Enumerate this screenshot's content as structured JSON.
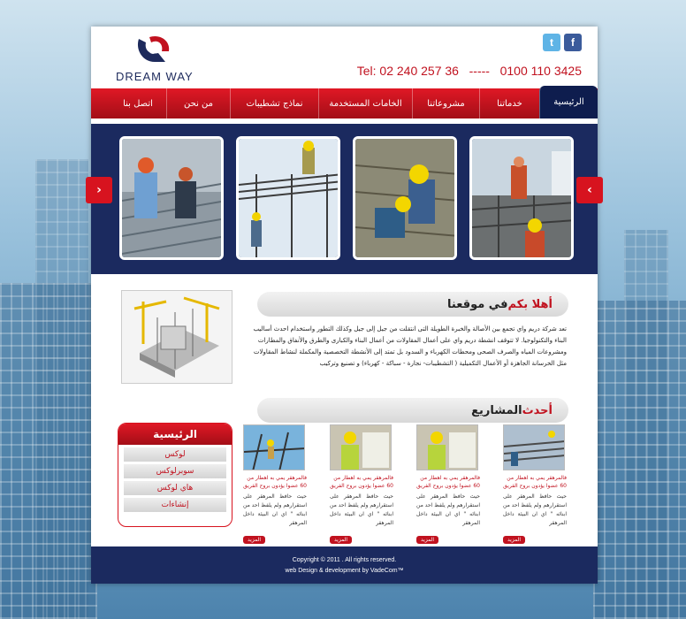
{
  "brand": {
    "name": "DREAM WAY"
  },
  "social": {
    "twitter": "t",
    "facebook": "f"
  },
  "contact": {
    "phones": "Tel: 02 240 257 36   -----   0100 110 3425"
  },
  "nav": {
    "items": [
      "الرئيسية",
      "خدماتنا",
      "مشروعاتنا",
      "الخامات المستخدمة",
      "نماذج تشطيبات",
      "من نحن",
      "اتصل بنا"
    ]
  },
  "slider": {
    "prev": "›",
    "next": "‹"
  },
  "welcome": {
    "title_accent": "أهلا بكم",
    "title_rest": " في موقعنا",
    "text": "تعد شركة دريم واي تجمع بين الأصالة والخبرة الطويلة التى انتقلت من جيل إلى جيل وكذلك التطور واستخدام احدث أساليب البناء والتكنولوجيا. لا تتوقف انشطة دريم واي على أعمال المقاولات من أعمال البناء والكبارى والطرق والأنفاق والمطارات ومشروعات المياه والصرف الصحى ومحطات الكهرباء و السدود بل تمتد إلى الأنشطة التخصصية والمكملة لنشاط المقاولات مثل الخرسانة الجاهزة أو الأعمال التكميلية ( التشطيبات- نجارة - سباكة - كهرباء) و تصنيع وتركيب"
  },
  "projects": {
    "title_accent": "أحدث",
    "title_rest": " المشاريع",
    "menu_title": "الرئيسية",
    "menu": [
      "لوكس",
      "سوبرلوكس",
      "هاي لوكس",
      "إنشاءات"
    ],
    "cards": [
      {
        "title": "فالمرهقر يمي به اهطار من 60 عضوا يؤدون بروح الفريق",
        "desc": "حيث حافظ المرهقر على استقرارهم ولم يلفظ احد من ابنائه \" اي ان البيئة داخل المرهقر",
        "more": "المزيد"
      },
      {
        "title": "فالمرهقر يمي به اهطار من 60 عضوا يؤدون بروح الفريق",
        "desc": "حيث حافظ المرهقر على استقرارهم ولم يلفظ احد من ابنائه \" اي ان البيئة داخل المرهقر",
        "more": "المزيد"
      },
      {
        "title": "فالمرهقر يمي به اهطار من 60 عضوا يؤدون بروح الفريق",
        "desc": "حيث حافظ المرهقر على استقرارهم ولم يلفظ احد من ابنائه \" اي ان البيئة داخل المرهقر",
        "more": "المزيد"
      },
      {
        "title": "فالمرهقر يمي به اهطار من 60 عضوا يؤدون بروح الفريق",
        "desc": "حيث حافظ المرهقر على استقرارهم ولم يلفظ احد من ابنائه \" اي ان البيئة داخل المرهقر",
        "more": "المزيد"
      }
    ]
  },
  "footer": {
    "copyright": "Copyright © 2011 . All rights reserved.",
    "credit": "web Design & development by VadeCom™"
  }
}
